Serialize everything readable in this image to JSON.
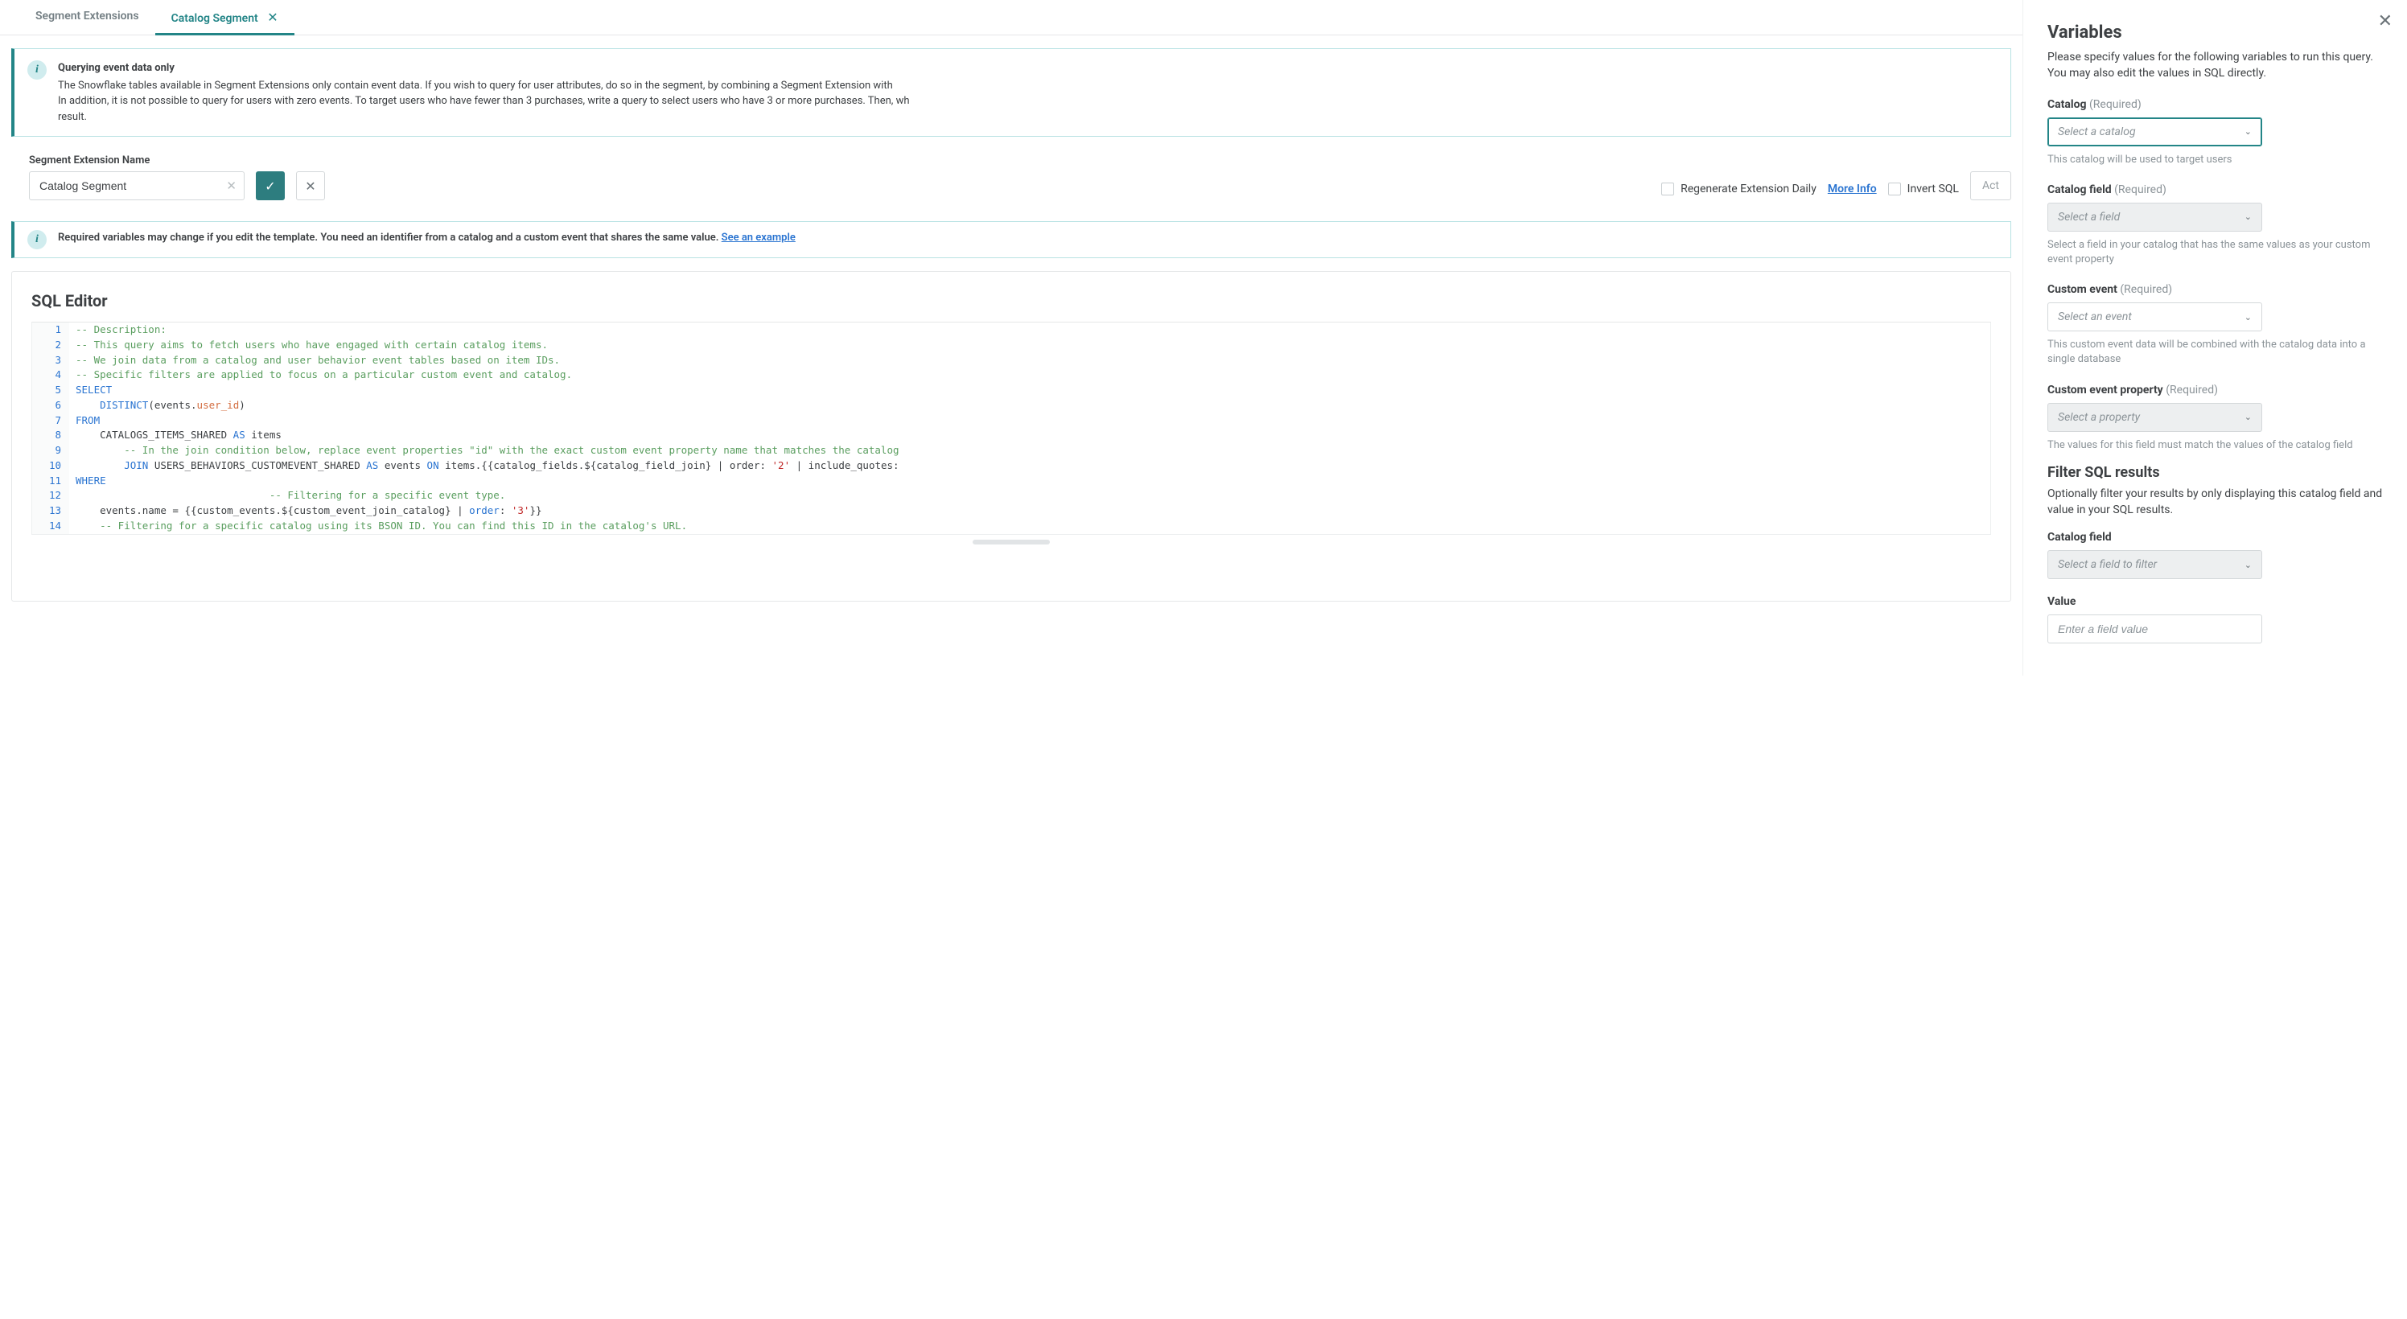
{
  "tabs": {
    "extensions": "Segment Extensions",
    "catalog": "Catalog Segment"
  },
  "infobox1": {
    "title": "Querying event data only",
    "body_a": "The Snowflake tables available in Segment Extensions only contain event data. If you wish to query for user attributes, do so in the segment, by combining a Segment Extension with ",
    "body_b": "In addition, it is not possible to query for users with zero events. To target users who have fewer than 3 purchases, write a query to select users who have 3 or more purchases. Then, wh",
    "body_c": "result."
  },
  "name_field": {
    "label": "Segment Extension Name",
    "value": "Catalog Segment"
  },
  "regen_label": "Regenerate Extension Daily",
  "more_info": "More Info",
  "invert_label": "Invert SQL",
  "actions_label": "Act",
  "infobox2": {
    "text": "Required variables may change if you edit the template. You need an identifier from a catalog and a custom event that shares the same value. ",
    "link": "See an example"
  },
  "sql_editor_title": "SQL Editor",
  "code_lines": [
    {
      "n": "1",
      "html": "<span class=\"tok-comment\">-- Description:</span>"
    },
    {
      "n": "2",
      "html": "<span class=\"tok-comment\">-- This query aims to fetch users who have engaged with certain catalog items.</span>"
    },
    {
      "n": "3",
      "html": "<span class=\"tok-comment\">-- We join data from a catalog and user behavior event tables based on item IDs.</span>"
    },
    {
      "n": "4",
      "html": "<span class=\"tok-comment\">-- Specific filters are applied to focus on a particular custom event and catalog.</span>"
    },
    {
      "n": "5",
      "html": "<span class=\"tok-kw\">SELECT</span>"
    },
    {
      "n": "6",
      "html": "    <span class=\"tok-kw\">DISTINCT</span>(events.<span class=\"tok-prop\">user_id</span>)"
    },
    {
      "n": "7",
      "html": "<span class=\"tok-kw\">FROM</span>"
    },
    {
      "n": "8",
      "html": "    CATALOGS_ITEMS_SHARED <span class=\"tok-kw\">AS</span> items"
    },
    {
      "n": "9",
      "html": "        <span class=\"tok-comment\">-- In the join condition below, replace event properties \"id\" with the exact custom event property name that matches the catalog</span>"
    },
    {
      "n": "10",
      "html": "        <span class=\"tok-kw\">JOIN</span> USERS_BEHAVIORS_CUSTOMEVENT_SHARED <span class=\"tok-kw\">AS</span> events <span class=\"tok-kw\">ON</span> items.{{catalog_fields.${catalog_field_join} | order: <span class=\"tok-str\">'2'</span> | include_quotes:"
    },
    {
      "n": "11",
      "html": "<span class=\"tok-kw\">WHERE</span>"
    },
    {
      "n": "12",
      "html": "                                <span class=\"tok-comment\">-- Filtering for a specific event type.</span>"
    },
    {
      "n": "13",
      "html": "    events.name = {{custom_events.${custom_event_join_catalog} | <span class=\"tok-kw\">order</span>: <span class=\"tok-str\">'3'</span>}}"
    },
    {
      "n": "14",
      "html": "    <span class=\"tok-comment\">-- Filtering for a specific catalog using its BSON ID. You can find this ID in the catalog's URL.</span>"
    }
  ],
  "panel": {
    "title": "Variables",
    "subtitle": "Please specify values for the following variables to run this query. You may also edit the values in SQL directly.",
    "catalog": {
      "label": "Catalog",
      "req": "(Required)",
      "placeholder": "Select a catalog",
      "help": "This catalog will be used to target users"
    },
    "catalog_field": {
      "label": "Catalog field",
      "req": "(Required)",
      "placeholder": "Select a field",
      "help": "Select a field in your catalog that has the same values as your custom event property"
    },
    "custom_event": {
      "label": "Custom event",
      "req": "(Required)",
      "placeholder": "Select an event",
      "help": "This custom event data will be combined with the catalog data into a single database"
    },
    "custom_prop": {
      "label": "Custom event property",
      "req": "(Required)",
      "placeholder": "Select a property",
      "help": "The values for this field must match the values of the catalog field"
    },
    "filter_title": "Filter SQL results",
    "filter_sub": "Optionally filter your results by only displaying this catalog field and value in your SQL results.",
    "filter_field": {
      "label": "Catalog field",
      "placeholder": "Select a field to filter"
    },
    "value_field": {
      "label": "Value",
      "placeholder": "Enter a field value"
    }
  }
}
